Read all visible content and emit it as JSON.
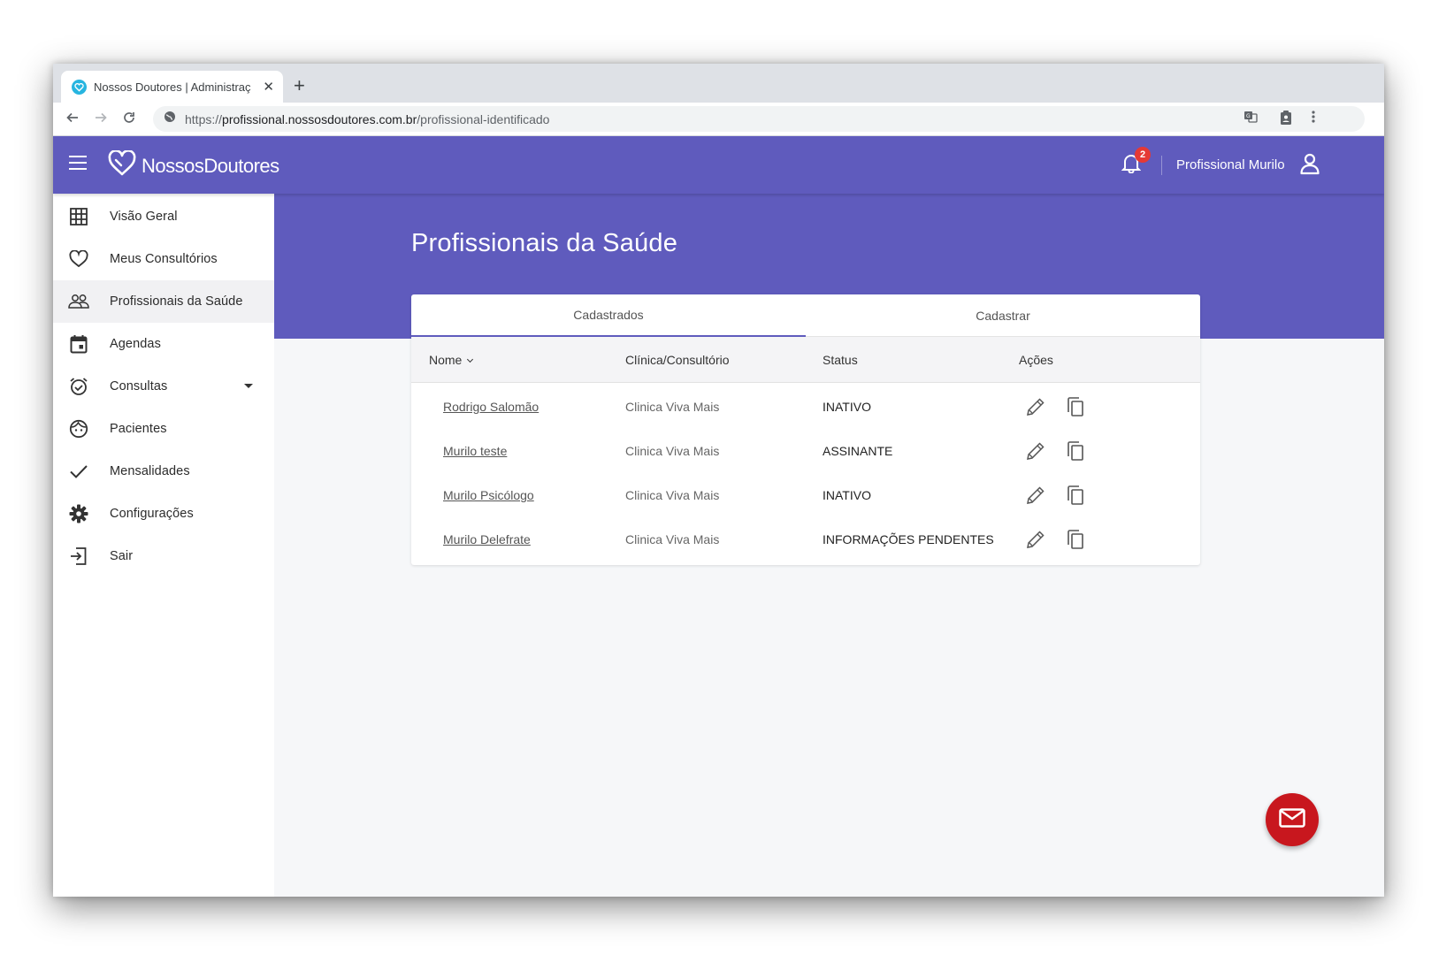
{
  "browser": {
    "tab_title": "Nossos Doutores | Administraç",
    "new_tab": "+",
    "url_scheme": "https://",
    "url_host": "profissional.nossosdoutores.com.br",
    "url_path": "/profissional-identificado"
  },
  "header": {
    "brand": "NossosDoutores",
    "notification_count": "2",
    "user_name": "Profissional Murilo",
    "brand_color": "#5f5bbd"
  },
  "sidebar": {
    "items": [
      {
        "label": "Visão Geral",
        "icon": "grid-icon"
      },
      {
        "label": "Meus Consultórios",
        "icon": "heart-icon"
      },
      {
        "label": "Profissionais da Saúde",
        "icon": "people-icon",
        "active": true
      },
      {
        "label": "Agendas",
        "icon": "calendar-icon"
      },
      {
        "label": "Consultas",
        "icon": "alarm-icon",
        "has_dropdown": true
      },
      {
        "label": "Pacientes",
        "icon": "face-icon"
      },
      {
        "label": "Mensalidades",
        "icon": "check-icon"
      },
      {
        "label": "Configurações",
        "icon": "gear-icon"
      },
      {
        "label": "Sair",
        "icon": "exit-icon"
      }
    ]
  },
  "main": {
    "title": "Profissionais da Saúde",
    "tabs": [
      {
        "label": "Cadastrados",
        "active": true
      },
      {
        "label": "Cadastrar",
        "active": false
      }
    ],
    "table": {
      "headers": [
        "Nome",
        "Clínica/Consultório",
        "Status",
        "Ações"
      ],
      "rows": [
        {
          "name": "Rodrigo Salomão",
          "clinic": "Clinica Viva Mais",
          "status": "INATIVO"
        },
        {
          "name": "Murilo teste",
          "clinic": "Clinica Viva Mais",
          "status": "ASSINANTE"
        },
        {
          "name": "Murilo Psicólogo",
          "clinic": "Clinica Viva Mais",
          "status": "INATIVO"
        },
        {
          "name": "Murilo Delefrate",
          "clinic": "Clinica Viva Mais",
          "status": "INFORMAÇÕES PENDENTES"
        }
      ]
    }
  },
  "fab": {
    "icon": "mail-icon",
    "color": "#c8171e"
  }
}
